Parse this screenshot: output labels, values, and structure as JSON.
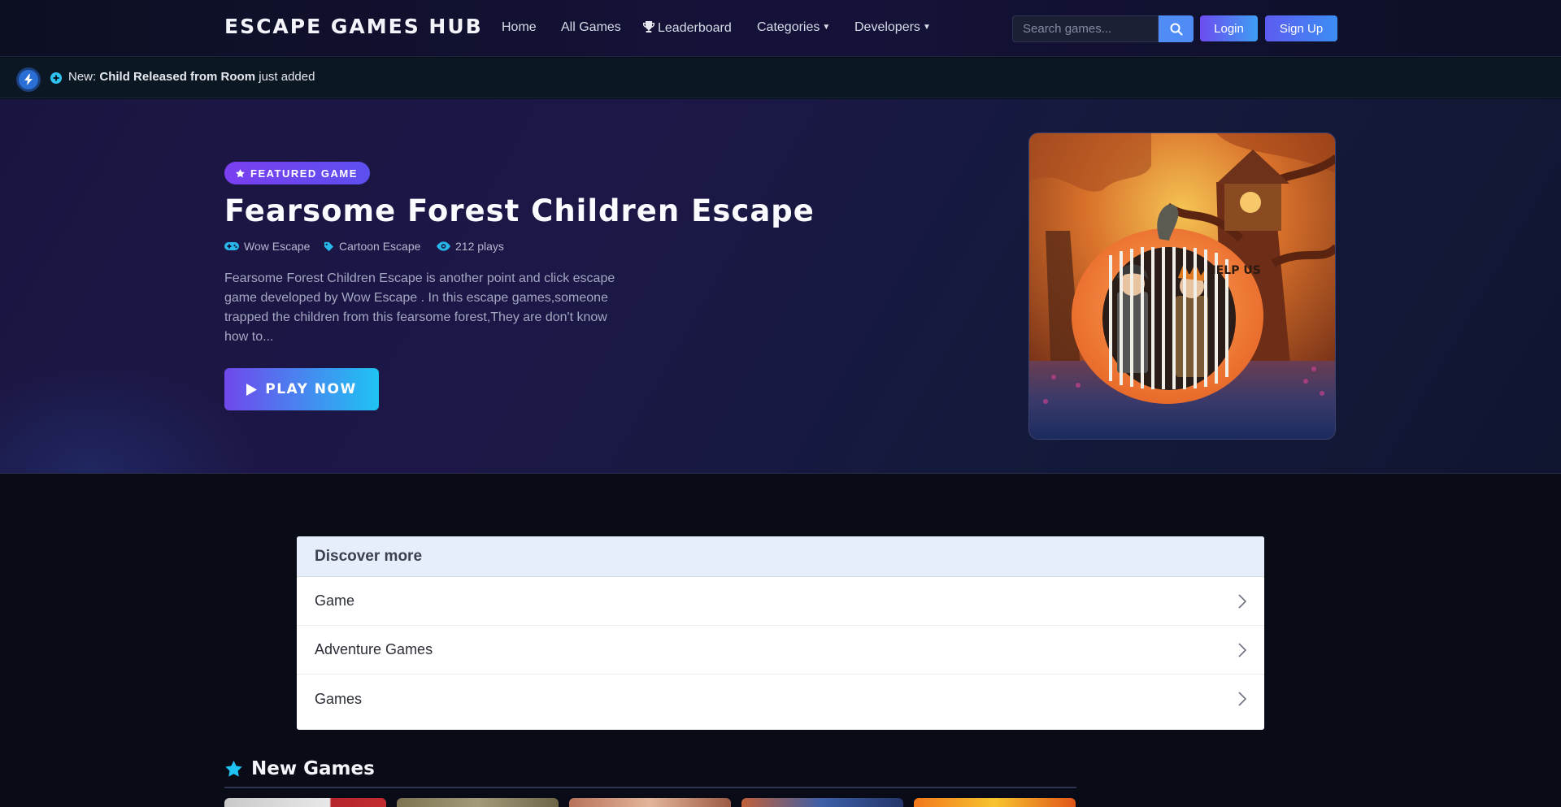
{
  "nav": {
    "brand": "ESCAPE GAMES HUB",
    "links": {
      "home": "Home",
      "all_games": "All Games",
      "leaderboard": "Leaderboard",
      "categories": "Categories",
      "developers": "Developers"
    },
    "search_placeholder": "Search games...",
    "login": "Login",
    "signup": "Sign Up"
  },
  "ticker": {
    "prefix": "New:",
    "game": "Child Released from Room",
    "suffix": "just added"
  },
  "hero": {
    "badge": "FEATURED GAME",
    "title": "Fearsome Forest Children Escape",
    "developer": "Wow Escape",
    "category": "Cartoon Escape",
    "plays": "212 plays",
    "description": "Fearsome Forest Children Escape is another point and click escape game developed by Wow Escape . In this escape games,someone trapped the children from this fearsome forest,They are don't know how to...",
    "play_button": "PLAY NOW",
    "image_caption": "HELP US"
  },
  "discover": {
    "title": "Discover more",
    "items": [
      "Game",
      "Adventure Games",
      "Games"
    ]
  },
  "new_games": {
    "title": "New Games"
  },
  "colors": {
    "accent_purple": "#7048ec",
    "accent_cyan": "#1fc3f3",
    "background": "#090c17"
  }
}
